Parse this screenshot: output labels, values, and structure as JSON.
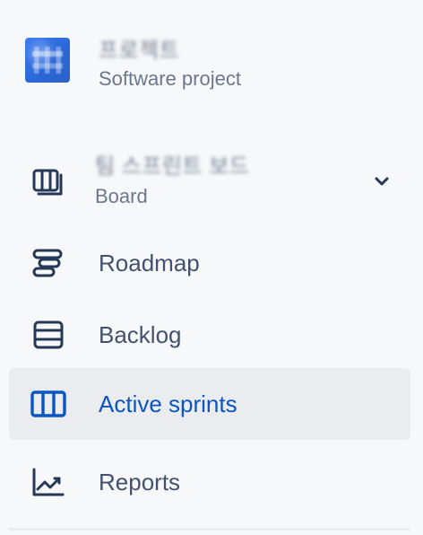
{
  "project": {
    "name": "프로젝트",
    "type": "Software project",
    "avatar_colors": {
      "primary": "#2a67d9",
      "secondary": "#3f7df0"
    }
  },
  "board": {
    "name": "팀 스프린트 보드",
    "subtitle": "Board",
    "icon": "board-icon",
    "chevron_icon": "chevron-down-icon"
  },
  "nav": {
    "items": [
      {
        "id": "roadmap",
        "label": "Roadmap",
        "icon": "roadmap-icon",
        "active": false
      },
      {
        "id": "backlog",
        "label": "Backlog",
        "icon": "backlog-icon",
        "active": false
      },
      {
        "id": "active-sprints",
        "label": "Active sprints",
        "icon": "columns-icon",
        "active": true
      },
      {
        "id": "reports",
        "label": "Reports",
        "icon": "chart-icon",
        "active": false
      }
    ]
  },
  "colors": {
    "sidebar_bg": "#f7f8fa",
    "text": "#42526e",
    "muted_text": "#6b778c",
    "active_bg": "#ebecf0",
    "active_text": "#0a55c2",
    "icon_dark": "#253858"
  }
}
